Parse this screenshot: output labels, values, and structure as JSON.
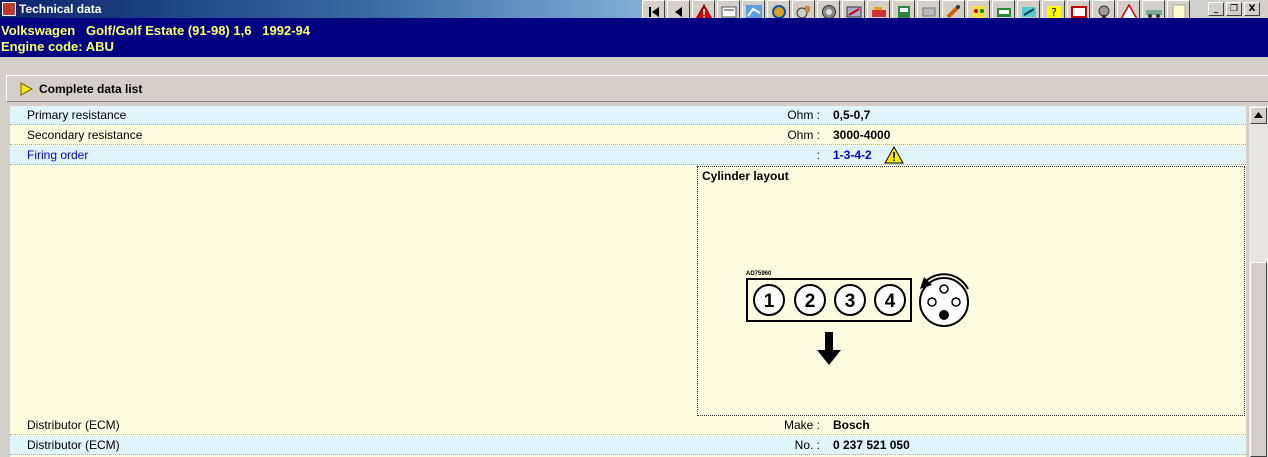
{
  "window": {
    "title": "Technical data",
    "controls": [
      "_",
      "❐",
      "X"
    ]
  },
  "toolbar": {
    "icons": [
      "first-page-icon",
      "previous-icon",
      "warning-icon",
      "document-icon",
      "diagram-icon",
      "engine-icon",
      "ignition-icon",
      "wheel-icon",
      "tools-icon",
      "service-icon",
      "fuel-icon",
      "ac-icon",
      "test-icon",
      "adjust-icon",
      "battery-icon",
      "electrical-icon",
      "help-icon",
      "repair-icon",
      "sensor-icon",
      "alert-icon",
      "car-icon",
      "info-icon"
    ]
  },
  "vehicle": {
    "line1": "Volkswagen   Golf/Golf Estate (91-98) 1,6   1992-94",
    "line2": "Engine code: ABU"
  },
  "datalist": {
    "label": "Complete data list"
  },
  "rows": [
    {
      "name": "Primary resistance",
      "unit": "Ohm :",
      "value": "0,5-0,7"
    },
    {
      "name": "Secondary resistance",
      "unit": "Ohm :",
      "value": "3000-4000"
    },
    {
      "name": "Firing order",
      "unit": ":",
      "value": "1-3-4-2"
    }
  ],
  "cylinder_layout": {
    "title": "Cylinder layout",
    "diagram_code": "AD75960",
    "cylinders": [
      "1",
      "2",
      "3",
      "4"
    ]
  },
  "bottom_rows": [
    {
      "name": "Distributor (ECM)",
      "unit": "Make :",
      "value": "Bosch"
    },
    {
      "name": "Distributor (ECM)",
      "unit": "No. :",
      "value": "0 237 521 050"
    }
  ],
  "colors": {
    "header_bg": "#000080",
    "header_text": "#ffff66",
    "row_alt": "#e0f4fb",
    "content_bg": "#fffde0",
    "link_blue": "#0000cc"
  }
}
